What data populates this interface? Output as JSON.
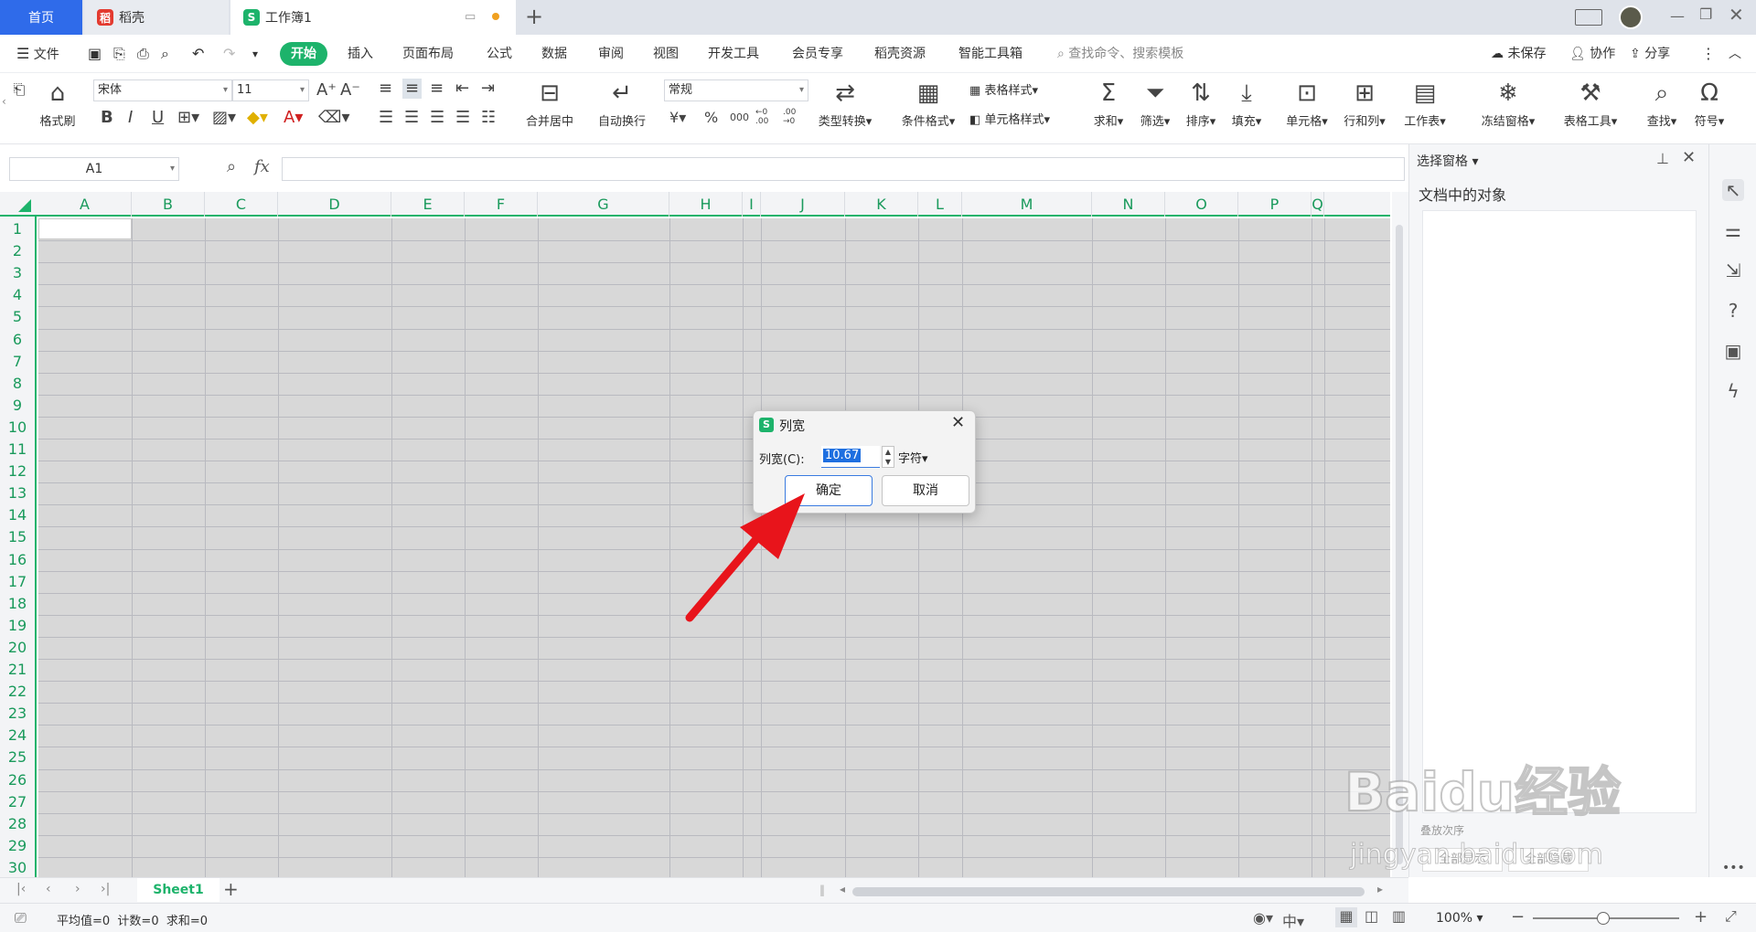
{
  "tabs": {
    "home": "首页",
    "daoke": "稻壳",
    "workbook": "工作簿1",
    "new_tab": "+"
  },
  "menu": {
    "file": "文件",
    "items": [
      "开始",
      "插入",
      "页面布局",
      "公式",
      "数据",
      "审阅",
      "视图",
      "开发工具",
      "会员专享",
      "稻壳资源",
      "智能工具箱"
    ],
    "search_placeholder": "查找命令、搜索模板",
    "unsaved": "未保存",
    "collab": "协作",
    "share": "分享"
  },
  "ribbon": {
    "format_painter": "格式刷",
    "font_name": "宋体",
    "font_size": "11",
    "merge_center": "合并居中",
    "wrap_text": "自动换行",
    "number_format": "常规",
    "type_convert": "类型转换",
    "cond_format": "条件格式",
    "table_style": "表格样式",
    "cell_style": "单元格样式",
    "sum": "求和",
    "filter": "筛选",
    "sort": "排序",
    "fill": "填充",
    "cell": "单元格",
    "row_col": "行和列",
    "worksheet": "工作表",
    "freeze": "冻结窗格",
    "table_tools": "表格工具",
    "find": "查找",
    "symbol": "符号",
    "currency": "¥",
    "percent": "%",
    "thousands": "000",
    "dec_inc": "←0 .00",
    "dec_dec": ".00 →0"
  },
  "formula_bar": {
    "name_box": "A1",
    "fx": "fx",
    "formula": ""
  },
  "grid": {
    "columns": [
      "A",
      "B",
      "C",
      "D",
      "E",
      "F",
      "G",
      "H",
      "I",
      "J",
      "K",
      "L",
      "M",
      "N",
      "O",
      "P",
      "Q"
    ],
    "rows": [
      "1",
      "2",
      "3",
      "4",
      "5",
      "6",
      "7",
      "8",
      "9",
      "10",
      "11",
      "12",
      "13",
      "14",
      "15",
      "16",
      "17",
      "18",
      "19",
      "20",
      "21",
      "22",
      "23",
      "24",
      "25",
      "26",
      "27",
      "28",
      "29",
      "30"
    ]
  },
  "right_pane": {
    "title": "选择窗格",
    "objects_label": "文档中的对象",
    "show_all": "全部显示",
    "hide_all": "全部隐藏",
    "overlap_label": "叠放次序"
  },
  "sheetbar": {
    "sheet_name": "Sheet1",
    "add": "+"
  },
  "statusbar": {
    "stats": "平均值=0  计数=0  求和=0",
    "zoom": "100%"
  },
  "dialog": {
    "title": "列宽",
    "label": "列宽(C):",
    "value": "10.67",
    "unit": "字符",
    "ok": "确定",
    "cancel": "取消"
  },
  "watermark": {
    "text": "Baidu经验",
    "url_text": "jingyan.baidu.com"
  },
  "colors": {
    "accent_green": "#1db36b",
    "home_tab_blue": "#2f6bea",
    "arrow_red": "#e8141b",
    "selection_blue": "#1e6fe0"
  }
}
